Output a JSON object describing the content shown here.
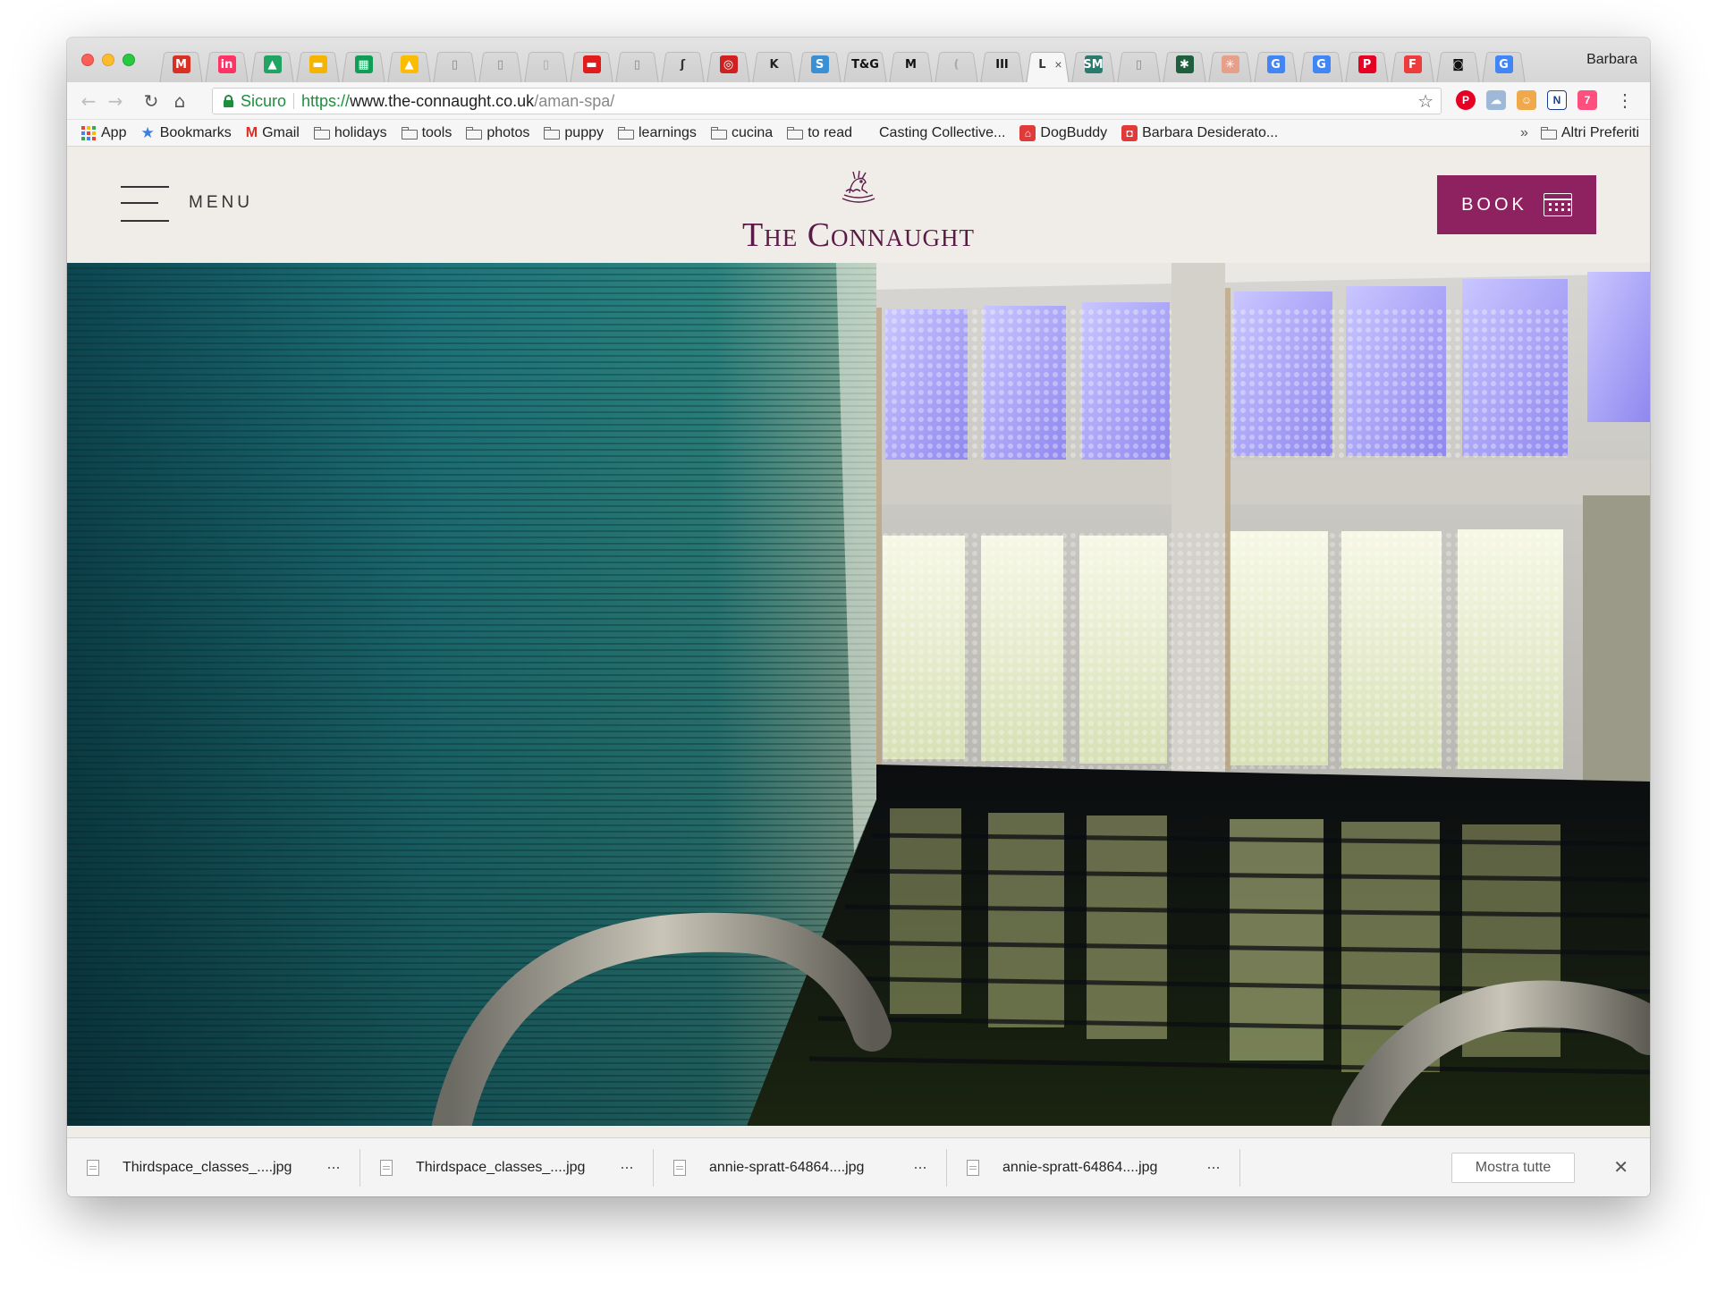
{
  "browser": {
    "profile_name": "Barbara",
    "tabs": [
      {
        "icon": "gmail-icon",
        "glyph": "M",
        "color": "#d93025"
      },
      {
        "icon": "invision-icon",
        "glyph": "in",
        "color": "#ff3366"
      },
      {
        "icon": "google-drive-icon",
        "glyph": "▲",
        "color": "#1fa463"
      },
      {
        "icon": "google-slides-icon",
        "glyph": "▬",
        "color": "#f4b400"
      },
      {
        "icon": "google-sheets-icon",
        "glyph": "▦",
        "color": "#0f9d58"
      },
      {
        "icon": "google-keep-icon",
        "glyph": "▲",
        "color": "#fbbc04"
      },
      {
        "icon": "document-icon",
        "glyph": "▯",
        "color": "#888888"
      },
      {
        "icon": "document-icon",
        "glyph": "▯",
        "color": "#888888"
      },
      {
        "icon": "document-icon",
        "glyph": "▯",
        "color": "#aaaaaa"
      },
      {
        "icon": "red-square-icon",
        "glyph": "▬",
        "color": "#e21b1b"
      },
      {
        "icon": "document-icon",
        "glyph": "▯",
        "color": "#888888"
      },
      {
        "icon": "quill-icon",
        "glyph": "ʃ",
        "color": "#333333"
      },
      {
        "icon": "red-circle-icon",
        "glyph": "◎",
        "color": "#d02020"
      },
      {
        "icon": "k-icon",
        "glyph": "K",
        "color": "#222222"
      },
      {
        "icon": "s-icon",
        "glyph": "S",
        "color": "#3b8fd4"
      },
      {
        "icon": "tg-icon",
        "glyph": "T&G",
        "color": "#111111"
      },
      {
        "icon": "m-icon",
        "glyph": "M",
        "color": "#111111"
      },
      {
        "icon": "loading-icon",
        "glyph": "(",
        "color": "#aaaaaa"
      },
      {
        "icon": "bars-icon",
        "glyph": "III",
        "color": "#111111"
      },
      {
        "icon": "connaught-tab-icon",
        "glyph": "L",
        "color": "#333333",
        "active": true
      },
      {
        "icon": "green-logo-icon",
        "glyph": "SM",
        "color": "#2b7a6e"
      },
      {
        "icon": "document-icon",
        "glyph": "▯",
        "color": "#888888"
      },
      {
        "icon": "pine-icon",
        "glyph": "✱",
        "color": "#1f5f3d"
      },
      {
        "icon": "flower-icon",
        "glyph": "✳",
        "color": "#e6a08a"
      },
      {
        "icon": "google-icon",
        "glyph": "G",
        "color": "#4285f4"
      },
      {
        "icon": "google-icon",
        "glyph": "G",
        "color": "#4285f4"
      },
      {
        "icon": "pinterest-icon",
        "glyph": "P",
        "color": "#e60023"
      },
      {
        "icon": "f-red-icon",
        "glyph": "F",
        "color": "#ee3b3b"
      },
      {
        "icon": "camera-icon",
        "glyph": "◙",
        "color": "#111111"
      },
      {
        "icon": "google-icon",
        "glyph": "G",
        "color": "#4285f4"
      }
    ],
    "address": {
      "secure_label": "Sicuro",
      "scheme": "https://",
      "host": "www.the-connaught.co.uk",
      "path": "/aman-spa/"
    },
    "bookmarks": [
      {
        "label": "App",
        "type": "apps"
      },
      {
        "label": "Bookmarks",
        "type": "star"
      },
      {
        "label": "Gmail",
        "type": "gmail"
      },
      {
        "label": "holidays",
        "type": "folder"
      },
      {
        "label": "tools",
        "type": "folder"
      },
      {
        "label": "photos",
        "type": "folder"
      },
      {
        "label": "puppy",
        "type": "folder"
      },
      {
        "label": "learnings",
        "type": "folder"
      },
      {
        "label": "cucina",
        "type": "folder"
      },
      {
        "label": "to read",
        "type": "folder"
      },
      {
        "label": "Casting Collective...",
        "type": "none"
      },
      {
        "label": "DogBuddy",
        "type": "dogbuddy"
      },
      {
        "label": "Barbara Desiderato...",
        "type": "red"
      }
    ],
    "bookmarks_overflow": "»",
    "bookmarks_other": "Altri Preferiti"
  },
  "site": {
    "menu_label": "MENU",
    "logo_text": "The Connaught",
    "book_label": "BOOK",
    "brand_color": "#8e2160"
  },
  "downloads": {
    "items": [
      "Thirdspace_classes_....jpg",
      "Thirdspace_classes_....jpg",
      "annie-spratt-64864....jpg",
      "annie-spratt-64864....jpg"
    ],
    "more_glyph": "···",
    "show_all": "Mostra tutte",
    "close_glyph": "✕"
  }
}
